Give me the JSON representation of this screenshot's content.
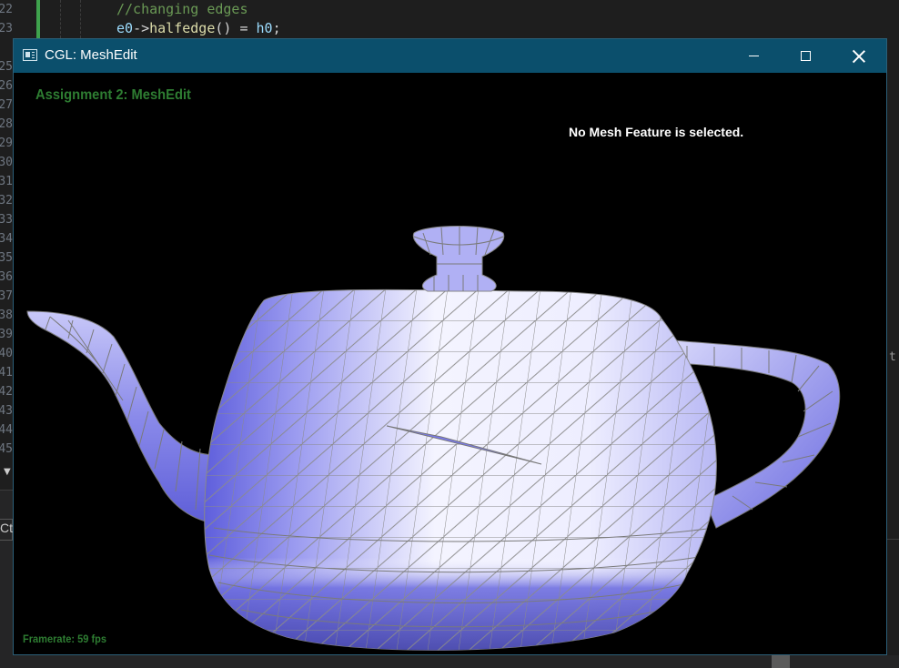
{
  "editor": {
    "line_numbers": [
      "22",
      "23",
      "25",
      "26",
      "27",
      "28",
      "29",
      "30",
      "31",
      "32",
      "33",
      "34",
      "35",
      "36",
      "37",
      "38",
      "39",
      "40",
      "41",
      "42",
      "43",
      "44",
      "45"
    ],
    "code_line_1": "//changing edges",
    "code_line_2": {
      "a": "e0",
      "b": "->",
      "c": "halfedge",
      "d": "() = ",
      "e": "h0",
      "f": ";"
    },
    "ct_label": "Ct",
    "right_peek": "t"
  },
  "window": {
    "title": "CGL: MeshEdit",
    "heading": "Assignment 2: MeshEdit",
    "status_text": "No Mesh Feature is selected.",
    "framerate_text": "Framerate: 59 fps"
  },
  "colors": {
    "titlebar": "#0b4f6c",
    "heading_green": "#2e7d32",
    "mesh_face": "#9c9cf0",
    "mesh_edge": "#808080"
  }
}
